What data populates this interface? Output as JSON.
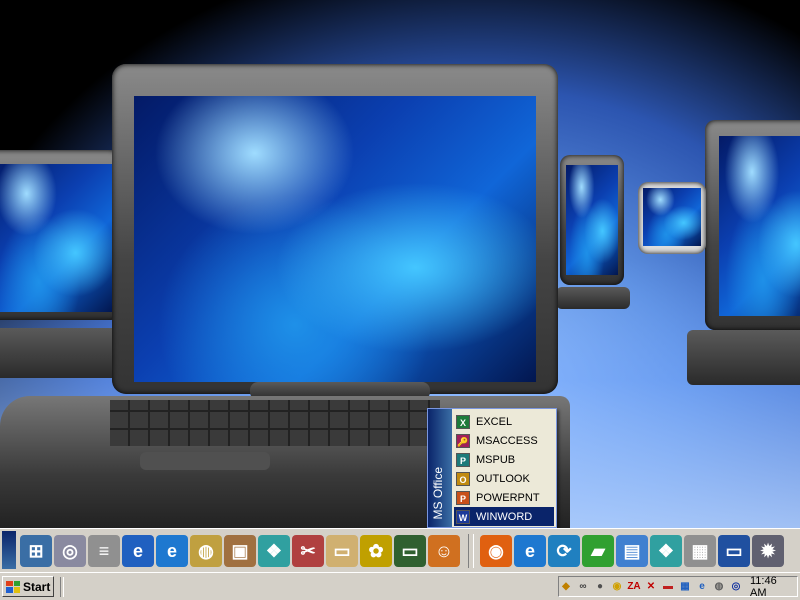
{
  "office_menu": {
    "title": "MS Office",
    "items": [
      {
        "label": "EXCEL",
        "icon": "excel-icon",
        "letter": "X",
        "color": "#1d7a3a"
      },
      {
        "label": "MSACCESS",
        "icon": "access-icon",
        "letter": "🔑",
        "color": "#a0205a"
      },
      {
        "label": "MSPUB",
        "icon": "publisher-icon",
        "letter": "P",
        "color": "#1c7a7a"
      },
      {
        "label": "OUTLOOK",
        "icon": "outlook-icon",
        "letter": "O",
        "color": "#c08a10"
      },
      {
        "label": "POWERPNT",
        "icon": "powerpoint-icon",
        "letter": "P",
        "color": "#c8501a"
      },
      {
        "label": "WINWORD",
        "icon": "word-icon",
        "letter": "W",
        "color": "#1c3a9a",
        "selected": true
      }
    ]
  },
  "quick_launch": [
    {
      "icon": "network-icon",
      "glyph": "⊞",
      "color": "#3a6ea5"
    },
    {
      "icon": "cd-icon",
      "glyph": "◎",
      "color": "#8a8aa0"
    },
    {
      "icon": "document-icon",
      "glyph": "≡",
      "color": "#909090"
    },
    {
      "icon": "ie-page-icon",
      "glyph": "e",
      "color": "#2060c0"
    },
    {
      "icon": "internet-explorer-icon",
      "glyph": "e",
      "color": "#1e78d0"
    },
    {
      "icon": "folder-globe-icon",
      "glyph": "◍",
      "color": "#c0a040"
    },
    {
      "icon": "package-icon",
      "glyph": "▣",
      "color": "#a07040"
    },
    {
      "icon": "cubes-icon",
      "glyph": "❖",
      "color": "#30a0a0"
    },
    {
      "icon": "tools-icon",
      "glyph": "✂",
      "color": "#b04040"
    },
    {
      "icon": "folder-icon",
      "glyph": "▭",
      "color": "#d0b070"
    },
    {
      "icon": "palette-icon",
      "glyph": "✿",
      "color": "#c0a000"
    },
    {
      "icon": "computer-icon",
      "glyph": "▭",
      "color": "#306030"
    },
    {
      "icon": "users-icon",
      "glyph": "☺",
      "color": "#d07020"
    }
  ],
  "quick_launch_2": [
    {
      "icon": "firefox-icon",
      "glyph": "◉",
      "color": "#e06010"
    },
    {
      "icon": "internet-explorer-icon",
      "glyph": "e",
      "color": "#1e78d0"
    },
    {
      "icon": "sync-icon",
      "glyph": "⟳",
      "color": "#2080c0"
    },
    {
      "icon": "notebook-icon",
      "glyph": "▰",
      "color": "#30a030"
    },
    {
      "icon": "notepad-icon",
      "glyph": "▤",
      "color": "#4080d0"
    },
    {
      "icon": "cubes-icon",
      "glyph": "❖",
      "color": "#30a0a0"
    },
    {
      "icon": "calculator-icon",
      "glyph": "▦",
      "color": "#909090"
    },
    {
      "icon": "window-icon",
      "glyph": "▭",
      "color": "#2050a0"
    },
    {
      "icon": "settings-gear-icon",
      "glyph": "✹",
      "color": "#606070"
    }
  ],
  "taskbar": {
    "start_label": "Start",
    "clock": "11:46 AM"
  },
  "tray_icons": [
    {
      "icon": "diamond-icon",
      "glyph": "◆",
      "color": "#c08000"
    },
    {
      "icon": "link-icon",
      "glyph": "∞",
      "color": "#404040"
    },
    {
      "icon": "disc-icon",
      "glyph": "●",
      "color": "#505050"
    },
    {
      "icon": "bulb-icon",
      "glyph": "◉",
      "color": "#d0a000"
    },
    {
      "icon": "zonealarm-icon",
      "glyph": "ZA",
      "color": "#c00000"
    },
    {
      "icon": "x-icon",
      "glyph": "✕",
      "color": "#c00000"
    },
    {
      "icon": "battery-icon",
      "glyph": "▬",
      "color": "#c02020"
    },
    {
      "icon": "network-tray-icon",
      "glyph": "▦",
      "color": "#2060c0"
    },
    {
      "icon": "ie-tray-icon",
      "glyph": "e",
      "color": "#2060c0"
    },
    {
      "icon": "shield-icon",
      "glyph": "◍",
      "color": "#606060"
    },
    {
      "icon": "speaker-icon",
      "glyph": "◎",
      "color": "#1030a0"
    }
  ]
}
